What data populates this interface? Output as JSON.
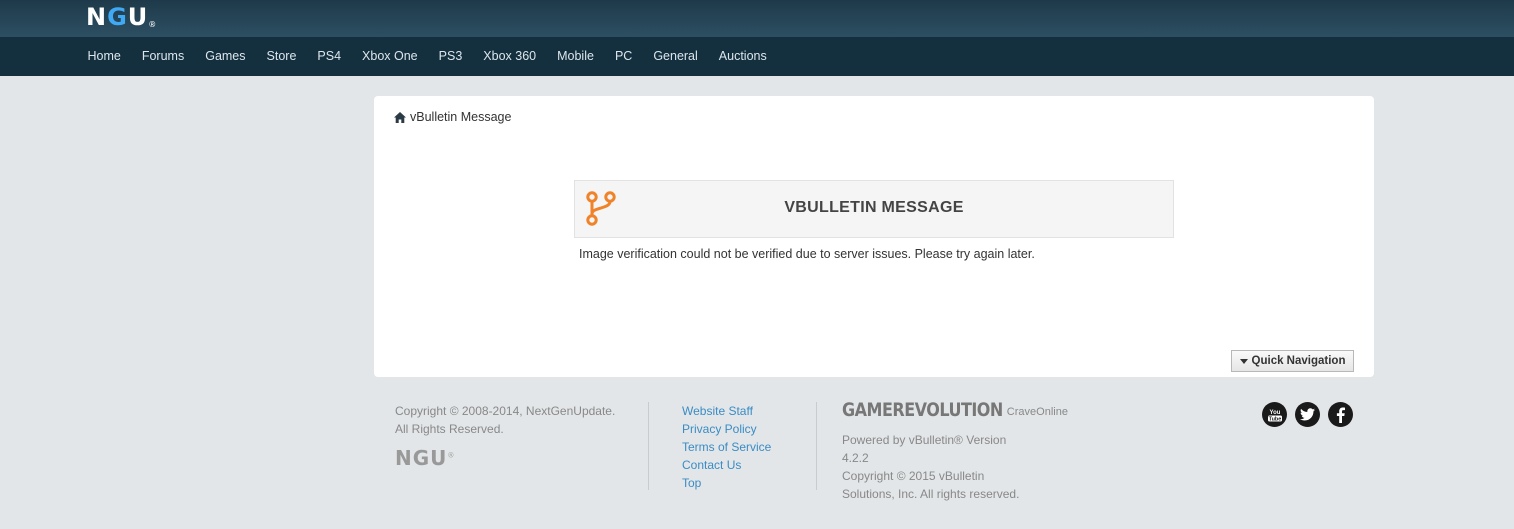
{
  "header": {
    "logo_main": "N",
    "logo_g": "G",
    "logo_end": "U",
    "logo_mark": "®"
  },
  "nav": {
    "items": [
      "Home",
      "Forums",
      "Games",
      "Store",
      "PS4",
      "Xbox One",
      "PS3",
      "Xbox 360",
      "Mobile",
      "PC",
      "General",
      "Auctions"
    ]
  },
  "breadcrumb": {
    "label": "vBulletin Message"
  },
  "message": {
    "title": "VBULLETIN MESSAGE",
    "text": "Image verification could not be verified due to server issues. Please try again later.",
    "icon": "branch-icon",
    "icon_color": "#f0832a"
  },
  "quicknav": {
    "label": "Quick Navigation"
  },
  "footer": {
    "copyright_line1": "Copyright © 2008-2014, NextGenUpdate.",
    "copyright_line2": "All Rights Reserved.",
    "logo": "NGU",
    "logo_mark": "®",
    "links": [
      "Website Staff",
      "Privacy Policy",
      "Terms of Service",
      "Contact Us",
      "Top"
    ],
    "gamerevolution": "GAMEREVOLUTION",
    "craveonline": "CraveOnline",
    "powered_1": "Powered by vBulletin® Version",
    "powered_2": "4.2.2",
    "powered_3": "Copyright © 2015 vBulletin",
    "powered_4": "Solutions, Inc. All rights reserved.",
    "social": [
      "youtube-icon",
      "twitter-icon",
      "facebook-icon"
    ]
  },
  "colors": {
    "topbar": "#1e3a4a",
    "navbar": "#14303f",
    "link": "#3a8cc4",
    "accent": "#3fa9f5",
    "icon_orange": "#f0832a"
  }
}
